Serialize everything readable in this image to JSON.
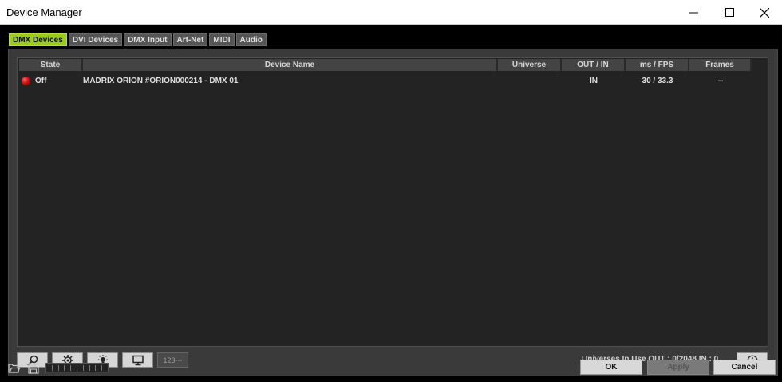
{
  "window": {
    "title": "Device Manager"
  },
  "tabs": [
    {
      "label": "DMX Devices",
      "active": true
    },
    {
      "label": "DVI Devices",
      "active": false
    },
    {
      "label": "DMX Input",
      "active": false
    },
    {
      "label": "Art-Net",
      "active": false
    },
    {
      "label": "MIDI",
      "active": false
    },
    {
      "label": "Audio",
      "active": false
    }
  ],
  "table": {
    "columns": [
      "State",
      "Device Name",
      "Universe",
      "OUT / IN",
      "ms / FPS",
      "Frames"
    ],
    "rows": [
      {
        "state": "Off",
        "device_name": "MADRIX ORION #ORION000214 - DMX 01",
        "universe": "",
        "out_in": "IN",
        "ms_fps": "30 / 33.3",
        "frames": "--"
      }
    ]
  },
  "toolbar": {
    "buttons": [
      "search-icon",
      "settings-icon",
      "light-icon",
      "monitor-icon",
      "numbering-icon"
    ],
    "numbering_label": "123···"
  },
  "status": {
    "universes_in_use": "Universes In Use OUT : 0/2048  IN : 0"
  },
  "footer": {
    "ok_label": "OK",
    "apply_label": "Apply",
    "cancel_label": "Cancel"
  },
  "colors": {
    "active_tab": "#9acd19",
    "led_off": "#cc0000"
  }
}
